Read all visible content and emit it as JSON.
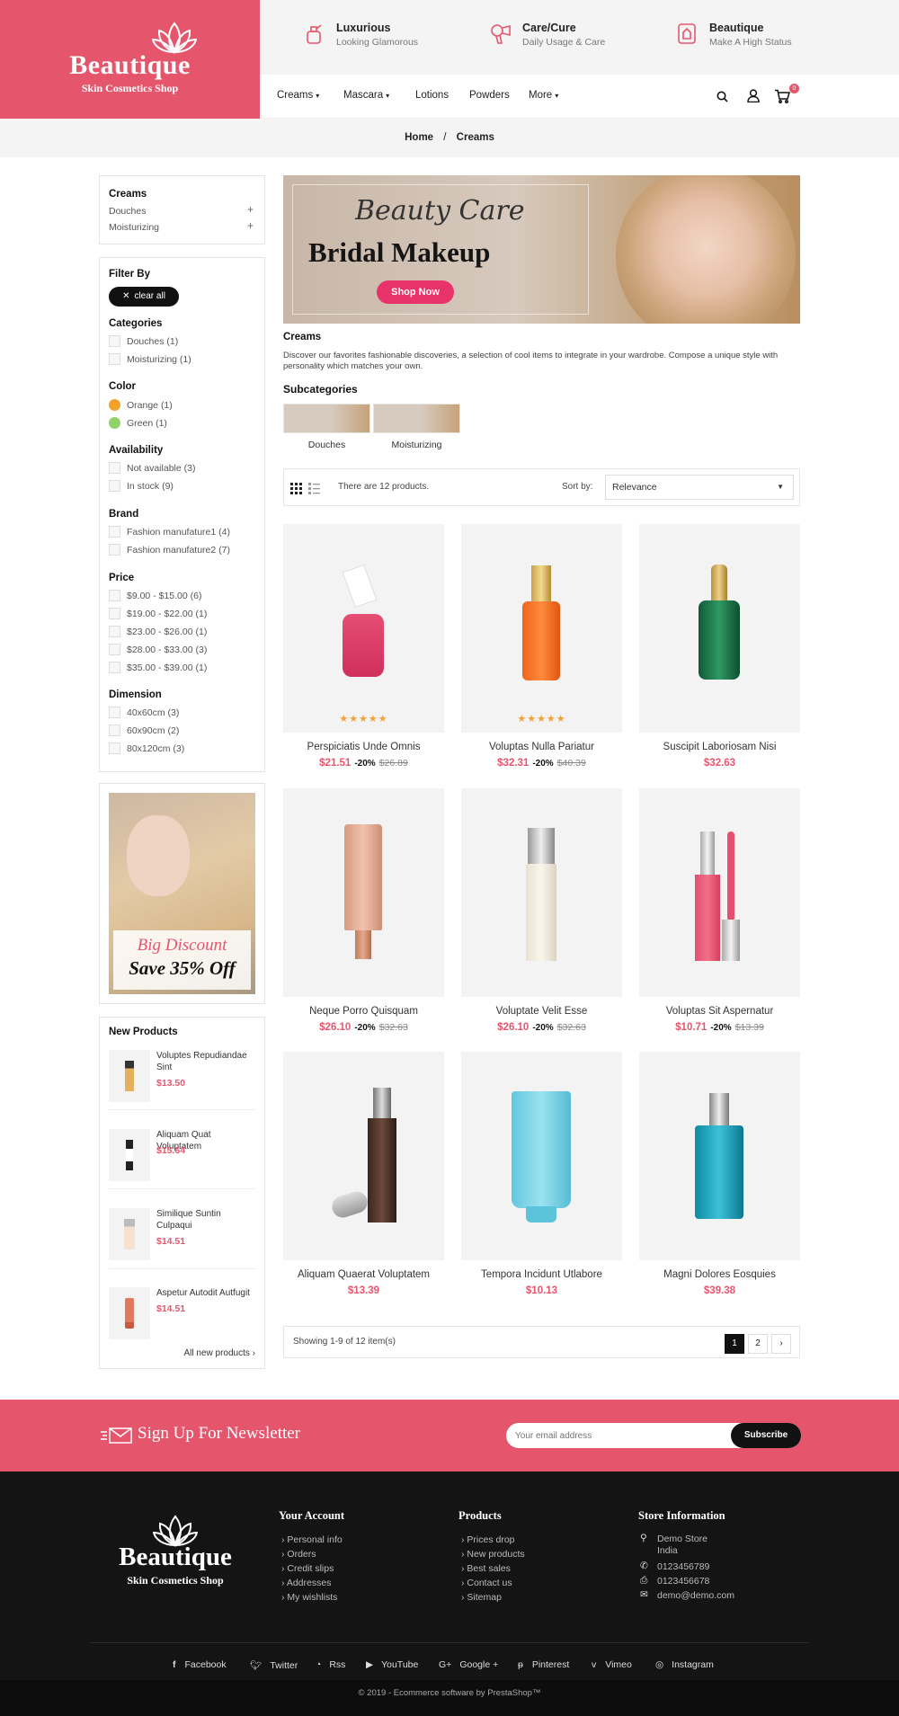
{
  "brand": {
    "name": "Beautique",
    "tagline": "Skin Cosmetics Shop"
  },
  "features": [
    {
      "title": "Luxurious",
      "subtitle": "Looking Glamorous",
      "icon": "perfume-icon"
    },
    {
      "title": "Care/Cure",
      "subtitle": "Daily Usage & Care",
      "icon": "hairdryer-icon"
    },
    {
      "title": "Beautique",
      "subtitle": "Make A High Status",
      "icon": "lipstick-icon"
    }
  ],
  "nav": [
    {
      "label": "Creams",
      "dropdown": true
    },
    {
      "label": "Mascara",
      "dropdown": true
    },
    {
      "label": "Lotions",
      "dropdown": false
    },
    {
      "label": "Powders",
      "dropdown": false
    },
    {
      "label": "More",
      "dropdown": true
    }
  ],
  "cart_count": "0",
  "breadcrumb": {
    "home": "Home",
    "sep": "/",
    "current": "Creams"
  },
  "category_box": {
    "title": "Creams",
    "items": [
      "Douches",
      "Moisturizing"
    ]
  },
  "filters": {
    "title": "Filter By",
    "clear_all": "clear all",
    "categories": {
      "title": "Categories",
      "items": [
        "Douches (1)",
        "Moisturizing (1)"
      ]
    },
    "color": {
      "title": "Color",
      "items": [
        {
          "label": "Orange (1)",
          "color": "#f2a22a"
        },
        {
          "label": "Green (1)",
          "color": "#8fd16a"
        }
      ]
    },
    "availability": {
      "title": "Availability",
      "items": [
        "Not available (3)",
        "In stock (9)"
      ]
    },
    "brand": {
      "title": "Brand",
      "items": [
        "Fashion manufature1 (4)",
        "Fashion manufature2 (7)"
      ]
    },
    "price": {
      "title": "Price",
      "items": [
        "$9.00 - $15.00 (6)",
        "$19.00 - $22.00 (1)",
        "$23.00 - $26.00 (1)",
        "$28.00 - $33.00 (3)",
        "$35.00 - $39.00 (1)"
      ]
    },
    "dimension": {
      "title": "Dimension",
      "items": [
        "40x60cm (3)",
        "60x90cm (2)",
        "80x120cm (3)"
      ]
    }
  },
  "promo": {
    "script": "Big Discount",
    "text": "Save 35% Off"
  },
  "new_products": {
    "title": "New Products",
    "items": [
      {
        "name": "Voluptes Repudiandae Sint",
        "price": "$13.50"
      },
      {
        "name": "Aliquam Quat Voluptatem",
        "price": "$15.64"
      },
      {
        "name": "Similique Suntin Culpaqui",
        "price": "$14.51"
      },
      {
        "name": "Aspetur Autodit Autfugit",
        "price": "$14.51"
      }
    ],
    "all_link": "All new products ›"
  },
  "banner": {
    "script": "Beauty Care",
    "title": "Bridal Makeup",
    "button": "Shop Now"
  },
  "category": {
    "title": "Creams",
    "description": "Discover our favorites fashionable discoveries, a selection of cool items to integrate in your wardrobe. Compose a unique style with personality which matches your own.",
    "subcategories_title": "Subcategories",
    "subcategories": [
      "Douches",
      "Moisturizing"
    ]
  },
  "sortbar": {
    "count_text": "There are 12 products.",
    "sort_label": "Sort by:",
    "sort_value": "Relevance"
  },
  "products": [
    {
      "name": "Perspiciatis Unde Omnis",
      "price": "$21.51",
      "discount": "-20%",
      "old": "$26.89",
      "stars": "★★★★★"
    },
    {
      "name": "Voluptas Nulla Pariatur",
      "price": "$32.31",
      "discount": "-20%",
      "old": "$40.39",
      "stars": "★★★★★"
    },
    {
      "name": "Suscipit Laboriosam Nisi",
      "price": "$32.63",
      "discount": "",
      "old": "",
      "stars": ""
    },
    {
      "name": "Neque Porro Quisquam",
      "price": "$26.10",
      "discount": "-20%",
      "old": "$32.63",
      "stars": ""
    },
    {
      "name": "Voluptate Velit Esse",
      "price": "$26.10",
      "discount": "-20%",
      "old": "$32.63",
      "stars": ""
    },
    {
      "name": "Voluptas Sit Aspernatur",
      "price": "$10.71",
      "discount": "-20%",
      "old": "$13.39",
      "stars": ""
    },
    {
      "name": "Aliquam Quaerat Voluptatem",
      "price": "$13.39",
      "discount": "",
      "old": "",
      "stars": ""
    },
    {
      "name": "Tempora Incidunt Utlabore",
      "price": "$10.13",
      "discount": "",
      "old": "",
      "stars": ""
    },
    {
      "name": "Magni Dolores Eosquies",
      "price": "$39.38",
      "discount": "",
      "old": "",
      "stars": ""
    }
  ],
  "pagination": {
    "showing": "Showing 1-9 of 12 item(s)",
    "pages": [
      "1",
      "2"
    ],
    "next": "›"
  },
  "newsletter": {
    "title": "Sign Up For Newsletter",
    "placeholder": "Your email address",
    "button": "Subscribe"
  },
  "footer": {
    "your_account": {
      "title": "Your Account",
      "links": [
        "Personal info",
        "Orders",
        "Credit slips",
        "Addresses",
        "My wishlists"
      ]
    },
    "products": {
      "title": "Products",
      "links": [
        "Prices drop",
        "New products",
        "Best sales",
        "Contact us",
        "Sitemap"
      ]
    },
    "store": {
      "title": "Store Information",
      "address_line1": "Demo Store",
      "address_line2": "India",
      "phone": "0123456789",
      "fax": "0123456678",
      "email": "demo@demo.com"
    },
    "social": [
      "Facebook",
      "Twitter",
      "Rss",
      "YouTube",
      "Google +",
      "Pinterest",
      "Vimeo",
      "Instagram"
    ],
    "copyright": "© 2019 - Ecommerce software by PrestaShop™"
  },
  "colors": {
    "accent": "#e5566d",
    "dark": "#141414",
    "price": "#e5566d",
    "star": "#f2a134",
    "banner_button": "#e8326a"
  }
}
